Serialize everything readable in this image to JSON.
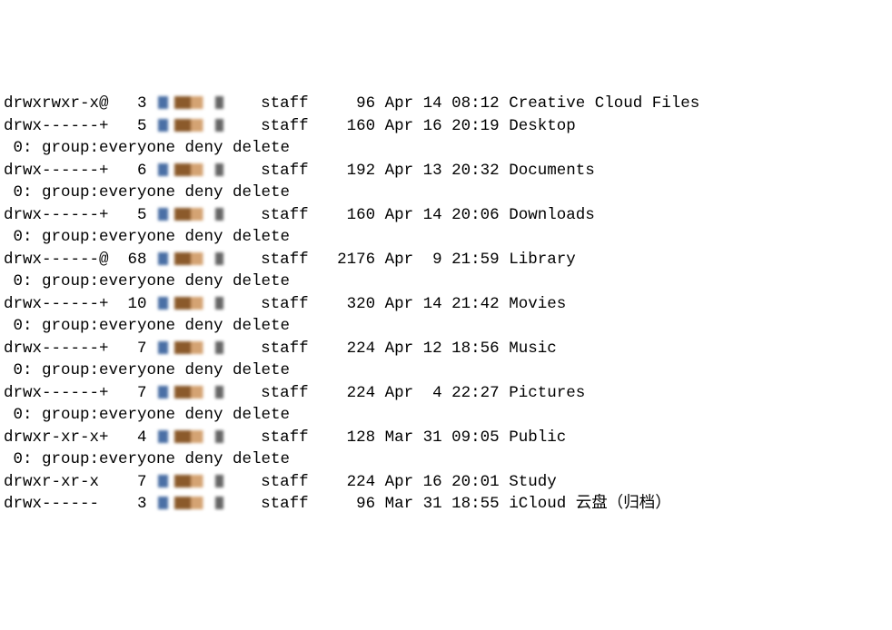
{
  "acl_text": " 0: group:everyone deny delete",
  "entries": [
    {
      "perms": "drwxrwxr-x@",
      "links": "  3",
      "group": "staff",
      "size": "   96",
      "date": "Apr 14 08:12",
      "name": "Creative Cloud Files",
      "acl": false
    },
    {
      "perms": "drwx------+",
      "links": "  5",
      "group": "staff",
      "size": "  160",
      "date": "Apr 16 20:19",
      "name": "Desktop",
      "acl": true
    },
    {
      "perms": "drwx------+",
      "links": "  6",
      "group": "staff",
      "size": "  192",
      "date": "Apr 13 20:32",
      "name": "Documents",
      "acl": true
    },
    {
      "perms": "drwx------+",
      "links": "  5",
      "group": "staff",
      "size": "  160",
      "date": "Apr 14 20:06",
      "name": "Downloads",
      "acl": true
    },
    {
      "perms": "drwx------@",
      "links": " 68",
      "group": "staff",
      "size": " 2176",
      "date": "Apr  9 21:59",
      "name": "Library",
      "acl": true
    },
    {
      "perms": "drwx------+",
      "links": " 10",
      "group": "staff",
      "size": "  320",
      "date": "Apr 14 21:42",
      "name": "Movies",
      "acl": true
    },
    {
      "perms": "drwx------+",
      "links": "  7",
      "group": "staff",
      "size": "  224",
      "date": "Apr 12 18:56",
      "name": "Music",
      "acl": true
    },
    {
      "perms": "drwx------+",
      "links": "  7",
      "group": "staff",
      "size": "  224",
      "date": "Apr  4 22:27",
      "name": "Pictures",
      "acl": true
    },
    {
      "perms": "drwxr-xr-x+",
      "links": "  4",
      "group": "staff",
      "size": "  128",
      "date": "Mar 31 09:05",
      "name": "Public",
      "acl": true
    },
    {
      "perms": "drwxr-xr-x ",
      "links": "  7",
      "group": "staff",
      "size": "  224",
      "date": "Apr 16 20:01",
      "name": "Study",
      "acl": false
    },
    {
      "perms": "drwx------ ",
      "links": "  3",
      "group": "staff",
      "size": "   96",
      "date": "Mar 31 18:55",
      "name": "iCloud 云盘（归档）",
      "acl": false
    }
  ]
}
